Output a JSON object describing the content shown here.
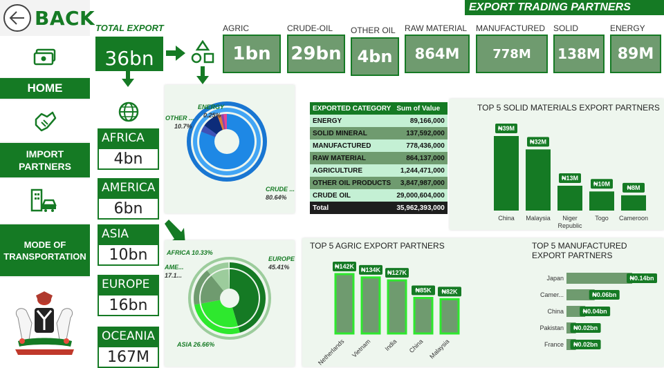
{
  "nav": {
    "back_label": "BACK",
    "home_label": "HOME",
    "import_label": "IMPORT PARTNERS",
    "mode_label": "MODE OF TRANSPORTATION"
  },
  "header": {
    "title": "EXPORT TRADING PARTNERS",
    "total_label": "TOTAL EXPORT",
    "total_value": "36bn"
  },
  "kpis": [
    {
      "label": "AGRIC",
      "value": "1bn"
    },
    {
      "label": "CRUDE-OIL",
      "value": "29bn"
    },
    {
      "label": "OTHER OIL",
      "value": "4bn"
    },
    {
      "label": "RAW MATERIAL",
      "value": "864M"
    },
    {
      "label": "MANUFACTURED",
      "value": "778M"
    },
    {
      "label": "SOLID",
      "value": "138M"
    },
    {
      "label": "ENERGY",
      "value": "89M"
    }
  ],
  "regions": [
    {
      "label": "AFRICA",
      "value": "4bn"
    },
    {
      "label": "AMERICA",
      "value": "6bn"
    },
    {
      "label": "ASIA",
      "value": "10bn"
    },
    {
      "label": "EUROPE",
      "value": "16bn"
    },
    {
      "label": "OCEANIA",
      "value": "167M"
    }
  ],
  "donut_category": {
    "labels": {
      "energy": "ENERGY",
      "energy_pct": "0.25%",
      "other": "OTHER ...",
      "other_pct": "10.7%",
      "crude": "CRUDE ...",
      "crude_pct": "80.64%"
    }
  },
  "donut_region": {
    "labels": {
      "africa": "AFRICA 10.33%",
      "america": "AME...",
      "america_pct": "17.1...",
      "europe": "EUROPE",
      "europe_pct": "45.41%",
      "asia": "ASIA 26.66%"
    }
  },
  "table": {
    "col1": "EXPORTED CATEGORY",
    "col2": "Sum of Value",
    "rows": [
      {
        "cat": "ENERGY",
        "val": "89,166,000"
      },
      {
        "cat": "SOLID MINERAL",
        "val": "137,592,000"
      },
      {
        "cat": "MANUFACTURED",
        "val": "778,436,000"
      },
      {
        "cat": "RAW MATERIAL",
        "val": "864,137,000"
      },
      {
        "cat": "AGRICULTURE",
        "val": "1,244,471,000"
      },
      {
        "cat": "OTHER OIL PRODUCTS",
        "val": "3,847,987,000"
      },
      {
        "cat": "CRUDE OIL",
        "val": "29,000,604,000"
      }
    ],
    "total_label": "Total",
    "total_val": "35,962,393,000"
  },
  "chart_data": [
    {
      "type": "bar",
      "title": "TOP 5 SOLID MATERIALS EXPORT PARTNERS",
      "categories": [
        "China",
        "Malaysia",
        "Niger Republic",
        "Togo",
        "Cameroon"
      ],
      "values": [
        39,
        32,
        13,
        10,
        8
      ],
      "data_labels": [
        "₦39M",
        "₦32M",
        "₦13M",
        "₦10M",
        "₦8M"
      ],
      "color": "#157a24"
    },
    {
      "type": "bar",
      "title": "TOP 5 AGRIC EXPORT PARTNERS",
      "categories": [
        "Netherlands",
        "Vietnam",
        "India",
        "China",
        "Malaysia"
      ],
      "values": [
        142,
        134,
        127,
        85,
        82
      ],
      "data_labels": [
        "₦142K",
        "₦134K",
        "₦127K",
        "₦85K",
        "₦82K"
      ],
      "color": "#6f9b6f",
      "border": "#2ee82e"
    },
    {
      "type": "bar",
      "orientation": "horizontal",
      "title": "TOP 5 MANUFACTURED EXPORT PARTNERS",
      "categories": [
        "Japan",
        "Camer...",
        "China",
        "Pakistan",
        "France"
      ],
      "values": [
        0.14,
        0.06,
        0.04,
        0.02,
        0.02
      ],
      "data_labels": [
        "₦0.14bn",
        "₦0.06bn",
        "₦0.04bn",
        "₦0.02bn",
        "₦0.02bn"
      ],
      "color": "#6f9b6f"
    }
  ]
}
